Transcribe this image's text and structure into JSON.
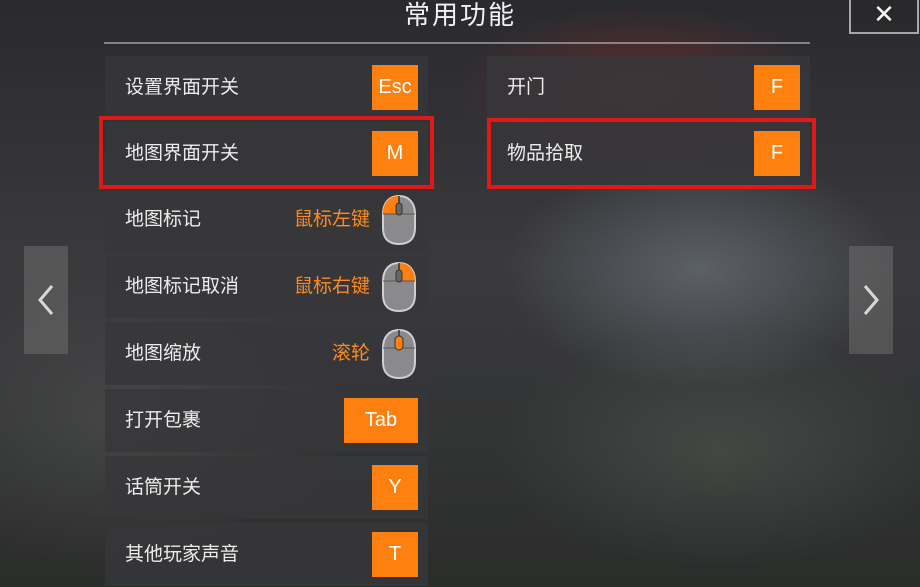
{
  "header": {
    "title": "常用功能",
    "close_label": "✕"
  },
  "navigation": {
    "prev_label": "‹",
    "next_label": "›"
  },
  "left_column": [
    {
      "label": "设置界面开关",
      "key": "Esc"
    },
    {
      "label": "地图界面开关",
      "key": "M",
      "highlighted": true
    },
    {
      "label": "地图标记",
      "mouse_text": "鼠标左键",
      "mouse_button": "left"
    },
    {
      "label": "地图标记取消",
      "mouse_text": "鼠标右键",
      "mouse_button": "right"
    },
    {
      "label": "地图缩放",
      "mouse_text": "滚轮",
      "mouse_button": "wheel"
    },
    {
      "label": "打开包裹",
      "key": "Tab"
    },
    {
      "label": "话筒开关",
      "key": "Y"
    },
    {
      "label": "其他玩家声音",
      "key": "T"
    }
  ],
  "right_column": [
    {
      "label": "开门",
      "key": "F"
    },
    {
      "label": "物品拾取",
      "key": "F",
      "highlighted": true
    }
  ],
  "colors": {
    "key_bg": "#ff7f0f",
    "mouse_text": "#ff8a1c",
    "highlight": "#e11818",
    "row_bg": "#37373a"
  },
  "icons": {
    "close": "close-icon",
    "prev": "chevron-left-icon",
    "next": "chevron-right-icon",
    "mouse": "mouse-icon"
  }
}
